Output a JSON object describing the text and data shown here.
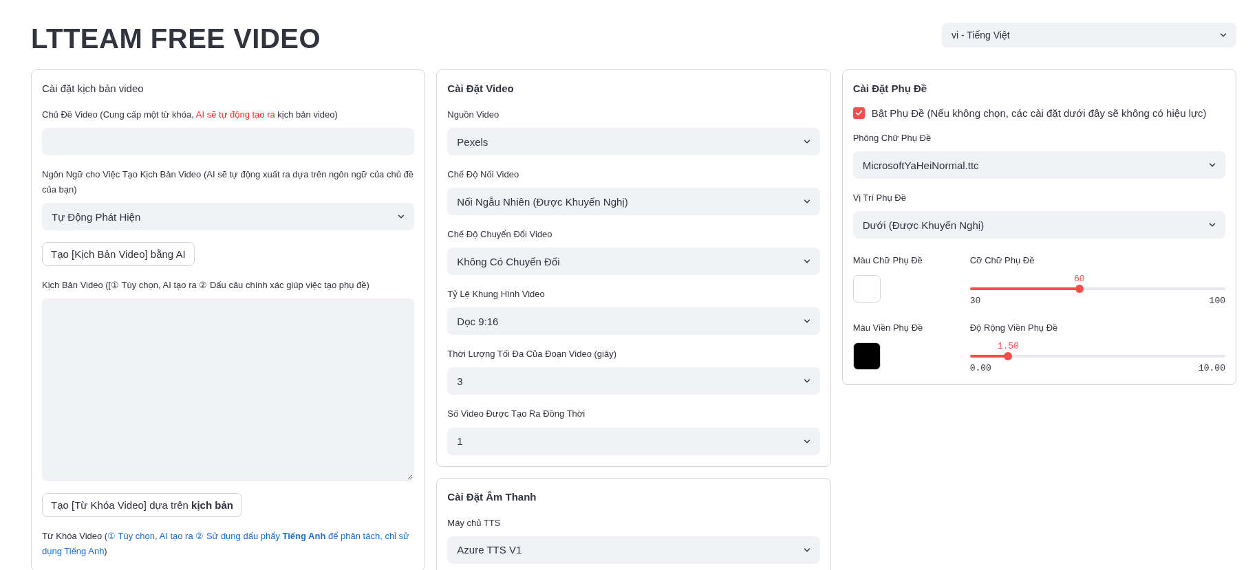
{
  "header": {
    "title": "LTTEAM FREE VIDEO",
    "language_select": {
      "value": "vi - Tiếng Việt"
    }
  },
  "columns": [
    {
      "cards": [
        {
          "heading": {
            "text": "Cài đặt kịch bản video",
            "emphasis": false
          },
          "items": [
            {
              "kind": "text_input",
              "label": [
                {
                  "text": "Chủ Đề Video (Cung cấp một từ khóa, ",
                  "kind": "plain"
                },
                {
                  "text": "AI sẽ tự động tạo ra",
                  "kind": "highlight"
                },
                {
                  "text": " kịch bản video)",
                  "kind": "plain"
                }
              ]
            },
            {
              "kind": "select",
              "label": [
                {
                  "text": "Ngôn Ngữ cho Việc Tạo Kịch Bản Video (AI sẽ tự động xuất ra dựa trên ngôn ngữ của chủ đề của bạn)",
                  "kind": "plain"
                }
              ],
              "value": "Tự Động Phát Hiện"
            },
            {
              "kind": "button",
              "text": "Tạo [Kịch Bản Video] bằng AI"
            },
            {
              "kind": "textarea",
              "label": [
                {
                  "text": "Kịch Bản Video ([① Tùy chọn, AI tạo ra ② Dấu câu chính xác giúp việc tạo phụ đề)",
                  "kind": "plain"
                }
              ]
            },
            {
              "kind": "button",
              "text": "Tạo [Từ Khóa Video] dựa trên **kịch bản**"
            },
            {
              "kind": "label",
              "label": [
                {
                  "text": "Từ Khóa Video (",
                  "kind": "plain"
                },
                {
                  "text": "① Tùy chọn, AI tạo ra ② Sử dụng dấu phẩy **Tiếng Anh** để phân tách, chỉ sử dụng Tiếng Anh",
                  "kind": "link"
                },
                {
                  "text": ")",
                  "kind": "plain"
                }
              ]
            }
          ]
        }
      ]
    },
    {
      "cards": [
        {
          "heading": {
            "text": "Cài Đặt Video",
            "emphasis": true
          },
          "items": [
            {
              "kind": "select",
              "label": [
                {
                  "text": "Nguồn Video",
                  "kind": "plain"
                }
              ],
              "value": "Pexels"
            },
            {
              "kind": "select",
              "label": [
                {
                  "text": "Chế Độ Nối Video",
                  "kind": "plain"
                }
              ],
              "value": "Nối Ngẫu Nhiên (Được Khuyến Nghị)"
            },
            {
              "kind": "select",
              "label": [
                {
                  "text": "Chế Độ Chuyển Đổi Video",
                  "kind": "plain"
                }
              ],
              "value": "Không Có Chuyển Đổi"
            },
            {
              "kind": "select",
              "label": [
                {
                  "text": "Tỷ Lệ Khung Hình Video",
                  "kind": "plain"
                }
              ],
              "value": "Dọc 9:16"
            },
            {
              "kind": "select",
              "label": [
                {
                  "text": "Thời Lượng Tối Đa Của Đoạn Video (giây)",
                  "kind": "plain"
                }
              ],
              "value": "3"
            },
            {
              "kind": "select",
              "label": [
                {
                  "text": "Số Video Được Tạo Ra Đồng Thời",
                  "kind": "plain"
                }
              ],
              "value": "1"
            }
          ]
        },
        {
          "heading": {
            "text": "Cài Đặt Âm Thanh",
            "emphasis": true
          },
          "items": [
            {
              "kind": "select",
              "label": [
                {
                  "text": "Máy chủ TTS",
                  "kind": "plain"
                }
              ],
              "value": "Azure TTS V1"
            }
          ]
        }
      ]
    },
    {
      "cards": [
        {
          "heading": {
            "text": "Cài Đặt Phụ Đề",
            "emphasis": true
          },
          "items": [
            {
              "kind": "checkbox",
              "label": "Bật Phụ Đề (Nếu không chọn, các cài đặt dưới đây sẽ không có hiệu lực)",
              "checked": true
            },
            {
              "kind": "select",
              "label": [
                {
                  "text": "Phông Chữ Phụ Đề",
                  "kind": "plain"
                }
              ],
              "value": "MicrosoftYaHeiNormal.ttc"
            },
            {
              "kind": "select",
              "label": [
                {
                  "text": "Vị Trí Phụ Đề",
                  "kind": "plain"
                }
              ],
              "value": "Dưới (Được Khuyến Nghị)"
            },
            {
              "kind": "color_slider",
              "color_label": "Màu Chữ Phụ Đề",
              "color": "#ffffff",
              "slider_label": "Cỡ Chữ Phụ Đề",
              "reading": "60",
              "min": "30",
              "max": "100",
              "level": 0.4286
            },
            {
              "kind": "color_slider",
              "color_label": "Màu Viền Phụ Đề",
              "color": "#000000",
              "slider_label": "Độ Rộng Viền Phụ Đề",
              "reading": "1.50",
              "min": "0.00",
              "max": "10.00",
              "level": 0.15
            }
          ]
        }
      ]
    }
  ]
}
